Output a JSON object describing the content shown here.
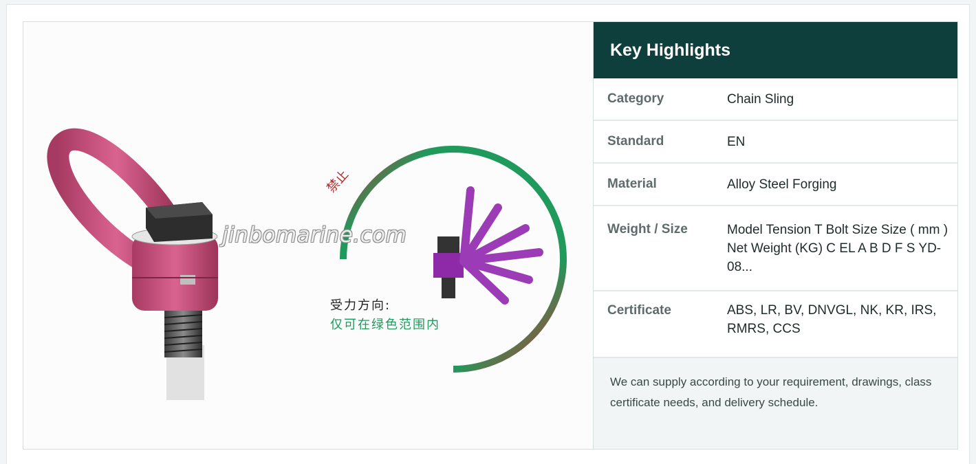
{
  "image": {
    "watermark": "jinbomarine.com",
    "label_forbidden": "禁止",
    "label_force_direction": "受力方向:",
    "label_green_range": "仅可在绿色范围内"
  },
  "highlights": {
    "title": "Key Highlights",
    "rows": [
      {
        "label": "Category",
        "value": "Chain Sling"
      },
      {
        "label": "Standard",
        "value": "EN"
      },
      {
        "label": "Material",
        "value": "Alloy Steel Forging"
      },
      {
        "label": "Weight / Size",
        "value": "Model Tension  T Bolt Size Size ( mm )  Net Weight (KG) C EL A B D F S YD-08..."
      },
      {
        "label": "Certificate",
        "value": "ABS, LR, BV, DNVGL, NK, KR, IRS, RMRS, CCS"
      }
    ],
    "note": "We can supply according to your requirement, drawings, class certificate needs, and delivery schedule."
  },
  "colors": {
    "header_bg": "#0f3f3d",
    "product_pink": "#c74a7a",
    "arc_red": "#d8262b",
    "arc_green": "#1f9a5c",
    "swing_purple": "#9b3bb5"
  }
}
